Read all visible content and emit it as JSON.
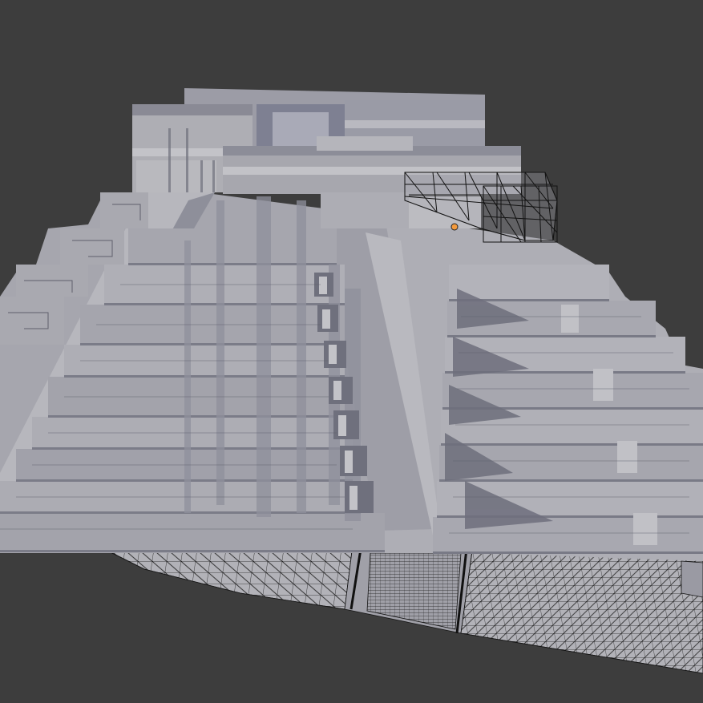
{
  "viewport": {
    "background": "#3d3d3d",
    "shaded_color": "#a4a4ad",
    "shade_dark": "#6d6e7a",
    "shade_light": "#c4c4c8",
    "wire_color": "#141414",
    "origin_color": "#f39a3c"
  }
}
